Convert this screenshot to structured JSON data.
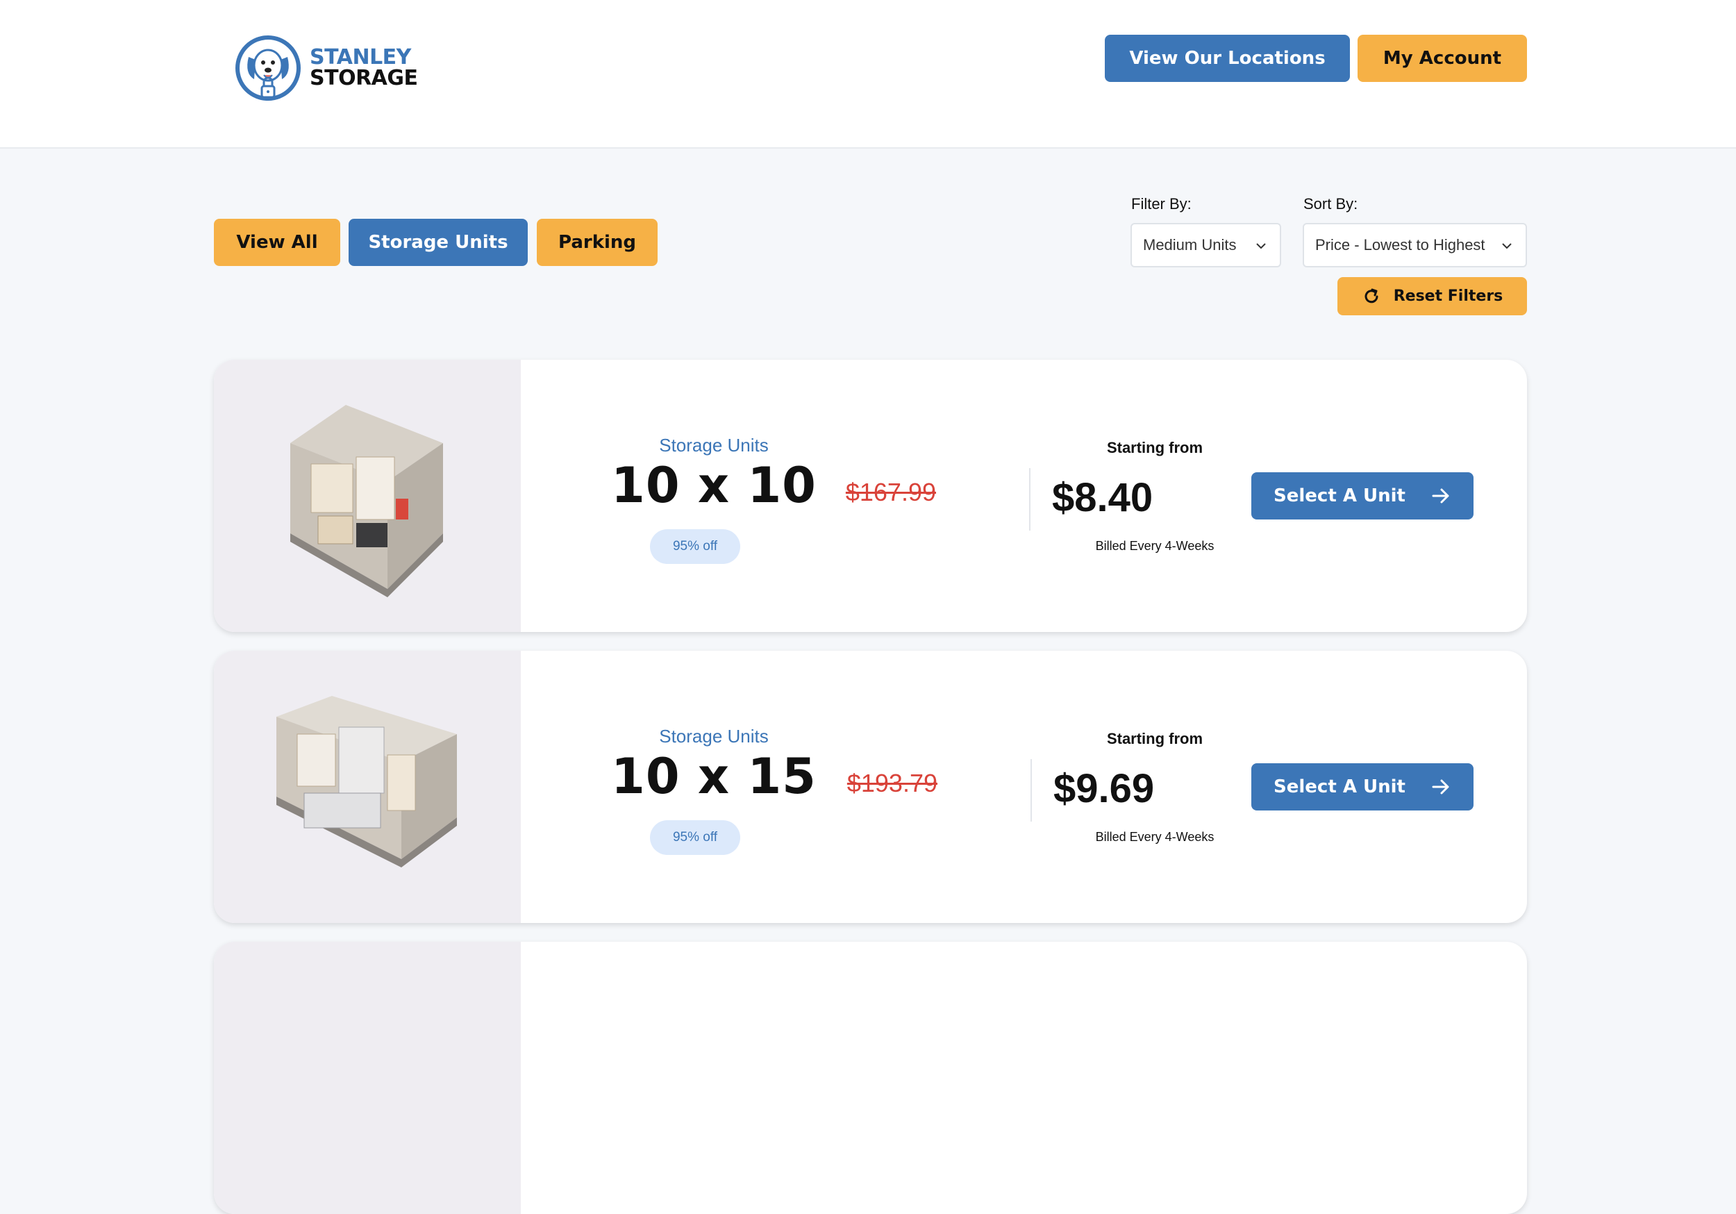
{
  "brand": {
    "line1": "STANLEY",
    "line2": "STORAGE"
  },
  "header": {
    "locations_label": "View Our Locations",
    "account_label": "My Account"
  },
  "tabs": [
    {
      "label": "View All",
      "active": false
    },
    {
      "label": "Storage Units",
      "active": true
    },
    {
      "label": "Parking",
      "active": false
    }
  ],
  "filters": {
    "filter_label": "Filter By:",
    "filter_value": "Medium Units",
    "sort_label": "Sort By:",
    "sort_value": "Price - Lowest to Highest",
    "reset_label": "Reset Filters"
  },
  "units": [
    {
      "category": "Storage Units",
      "size": "10 x 10",
      "discount": "95% off",
      "starting_label": "Starting from",
      "old_price": "$167.99",
      "price": "$8.40",
      "billing": "Billed Every 4-Weeks",
      "cta": "Select A Unit"
    },
    {
      "category": "Storage Units",
      "size": "10 x 15",
      "discount": "95% off",
      "starting_label": "Starting from",
      "old_price": "$193.79",
      "price": "$9.69",
      "billing": "Billed Every 4-Weeks",
      "cta": "Select A Unit"
    }
  ],
  "colors": {
    "brand_blue": "#3c76b7",
    "brand_orange": "#f6b146",
    "strike_red": "#d9433a",
    "pill_bg": "#dce9fb"
  }
}
